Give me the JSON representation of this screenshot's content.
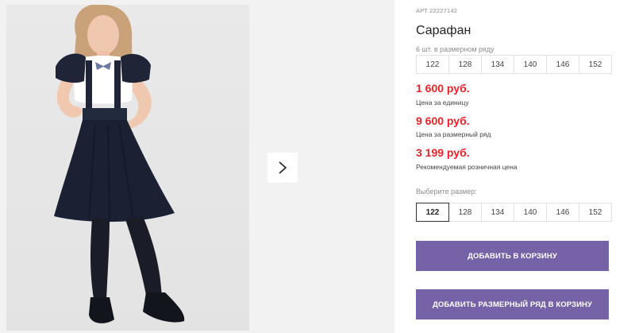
{
  "product": {
    "article": "АРТ 22227142",
    "title": "Сарафан",
    "pack_info": "6 шт. в размерном ряду",
    "pack_sizes": [
      "122",
      "128",
      "134",
      "140",
      "146",
      "152"
    ]
  },
  "prices": [
    {
      "value": "1 600 руб.",
      "label": "Цена за единицу"
    },
    {
      "value": "9 600 руб.",
      "label": "Цена за размерный ряд"
    },
    {
      "value": "3 199 руб.",
      "label": "Рекомендуемая розничная цена"
    }
  ],
  "size_select": {
    "label": "Выберите размер:",
    "options": [
      "122",
      "128",
      "134",
      "140",
      "146",
      "152"
    ],
    "selected": "122"
  },
  "buttons": {
    "add_to_cart": "ДОБАВИТЬ В КОРЗИНУ",
    "add_pack_to_cart": "ДОБАВИТЬ РАЗМЕРНЫЙ РЯД В КОРЗИНУ"
  },
  "gallery": {
    "next_icon": "chevron-right-icon"
  },
  "colors": {
    "accent": "#7662a6",
    "price": "#e5232c"
  }
}
